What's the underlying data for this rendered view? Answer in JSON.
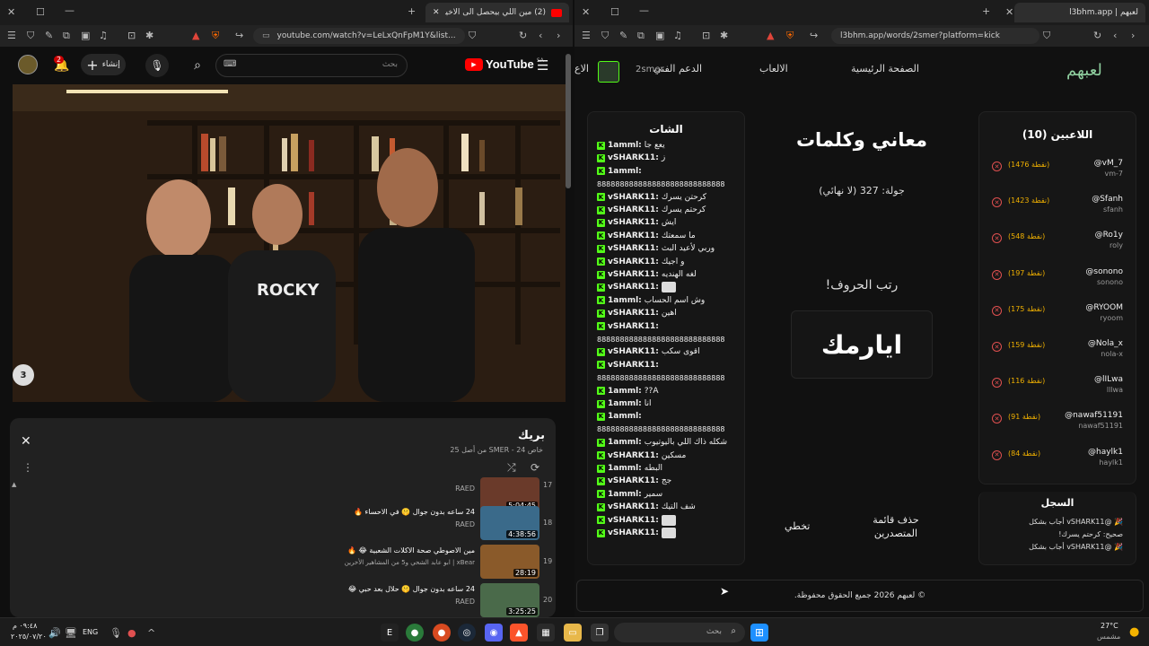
{
  "left_window": {
    "tab_title": "(2) مين اللي بيحصل الى الاخير؟",
    "address": "youtube.com/watch?v=LeLxQnFpM1Y&list...",
    "youtube": {
      "logo": "YouTube",
      "region": "SA",
      "search_placeholder": "بحث",
      "create_label": "إنشاء",
      "notif_count": "2"
    },
    "playlist": {
      "title": "بريك",
      "meta": "خاص SMER - 24 من أصل 25",
      "items": [
        {
          "index": "17",
          "title": "",
          "channel": "RAED",
          "duration": "5:04:45"
        },
        {
          "index": "18",
          "title": "24 ساعه بدون جوال 🤫 في الاحساء 🔥",
          "channel": "RAED",
          "duration": "4:38:56"
        },
        {
          "index": "19",
          "title": "مين الاصوطي صحة الاكلات الشعبية 😂 🔥",
          "channel": "xBear | ابو عابد الشحي و5 من المشاهير الأخرين",
          "duration": "28:19"
        },
        {
          "index": "20",
          "title": "24 ساعه بدون جوال 🤫 حلال بعد حبي 😂",
          "channel": "RAED",
          "duration": "3:25:25"
        }
      ]
    }
  },
  "right_window": {
    "tab_title": "لعبهم | l3bhm.app",
    "address": "l3bhm.app/words/2smer?platform=kick",
    "site": {
      "logo": "لعبهم",
      "nav": [
        "الصفحة الرئيسية",
        "الالعاب",
        "الدعم الفني",
        "الاع"
      ],
      "user_handle": "2smer"
    },
    "chat": {
      "title": "الشات",
      "lines": [
        {
          "user": "1amml:",
          "text": "يعع جا"
        },
        {
          "user": "vSHARK11:",
          "text": "ز"
        },
        {
          "user": "1amml:",
          "text": ""
        },
        {
          "user": "",
          "text": "8888888888888888888888888888"
        },
        {
          "user": "vSHARK11:",
          "text": "كرحتن يسرك"
        },
        {
          "user": "vSHARK11:",
          "text": "كرحتم يسرك"
        },
        {
          "user": "vSHARK11:",
          "text": "ايش"
        },
        {
          "user": "vSHARK11:",
          "text": "ما سمعتك"
        },
        {
          "user": "vSHARK11:",
          "text": "وربي لأعيد البث"
        },
        {
          "user": "vSHARK11:",
          "text": "و اجيك"
        },
        {
          "user": "vSHARK11:",
          "text": "لغه الهنديه"
        },
        {
          "user": "vSHARK11:",
          "text": "[emote]"
        },
        {
          "user": "1amml:",
          "text": "وش اسم الحساب"
        },
        {
          "user": "vSHARK11:",
          "text": "اهين"
        },
        {
          "user": "vSHARK11:",
          "text": ""
        },
        {
          "user": "",
          "text": "8888888888888888888888888888"
        },
        {
          "user": "vSHARK11:",
          "text": "اقوى سكب"
        },
        {
          "user": "vSHARK11:",
          "text": ""
        },
        {
          "user": "",
          "text": "8888888888888888888888888888"
        },
        {
          "user": "1amml:",
          "text": "A??"
        },
        {
          "user": "1amml:",
          "text": "انا"
        },
        {
          "user": "1amml:",
          "text": ""
        },
        {
          "user": "",
          "text": "8888888888888888888888888888"
        },
        {
          "user": "1amml:",
          "text": "شكله ذاك اللي باليوتيوب"
        },
        {
          "user": "vSHARK11:",
          "text": "مسكين"
        },
        {
          "user": "1amml:",
          "text": "البطه"
        },
        {
          "user": "vSHARK11:",
          "text": "جج"
        },
        {
          "user": "1amml:",
          "text": "سمير"
        },
        {
          "user": "vSHARK11:",
          "text": "شف التيك"
        },
        {
          "user": "vSHARK11:",
          "text": "[emote]"
        },
        {
          "user": "vSHARK11:",
          "text": "[emote]"
        }
      ]
    },
    "game": {
      "title": "معاني وكلمات",
      "round": "جولة: 327 (لا نهائي)",
      "instruction": "رتب الحروف!",
      "scrambled": "ايارمك",
      "clear_leaderboard": "حذف قائمة المتصدرين",
      "skip": "تخطي"
    },
    "players": {
      "title": "اللاعبين (10)",
      "list": [
        {
          "name": "@vM_7",
          "sub": "vm-7",
          "points": "(1476 نقطة)"
        },
        {
          "name": "@Sfanh",
          "sub": "sfanh",
          "points": "(1423 نقطة)"
        },
        {
          "name": "@Ro1y",
          "sub": "roly",
          "points": "(548 نقطة)"
        },
        {
          "name": "@sonono",
          "sub": "sonono",
          "points": "(197 نقطة)"
        },
        {
          "name": "@RYOOM",
          "sub": "ryoom",
          "points": "(175 نقطة)"
        },
        {
          "name": "@Nola_x",
          "sub": "nola-x",
          "points": "(159 نقطة)"
        },
        {
          "name": "@lILwa",
          "sub": "lllwa",
          "points": "(116 نقطة)"
        },
        {
          "name": "@nawaf51191",
          "sub": "nawaf51191",
          "points": "(91 نقطة)"
        },
        {
          "name": "@haylk1",
          "sub": "haylk1",
          "points": "(84 نقطة)"
        }
      ]
    },
    "log": {
      "title": "السجل",
      "lines": [
        "🎉 @vSHARK11 أجاب بشكل",
        "صحيح: كرحتم يسرك!",
        "🎉 @vSHARK11 أجاب بشكل"
      ]
    },
    "footer": "© لعبهم 2026 جميع الحقوق محفوظة."
  },
  "taskbar": {
    "time": "٠٩:٤٨ م",
    "date": "٢٠٢٥/٠٧/٢٠",
    "lang": "ENG",
    "search_placeholder": "بحث",
    "weather_temp": "27°C",
    "weather_desc": "مشمس"
  }
}
